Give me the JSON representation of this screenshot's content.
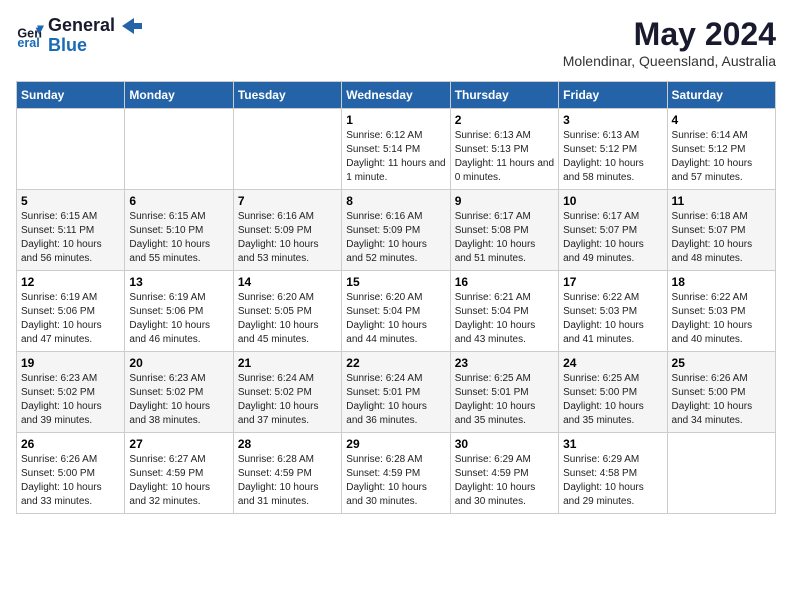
{
  "header": {
    "logo_general": "General",
    "logo_blue": "Blue",
    "month_year": "May 2024",
    "location": "Molendinar, Queensland, Australia"
  },
  "weekdays": [
    "Sunday",
    "Monday",
    "Tuesday",
    "Wednesday",
    "Thursday",
    "Friday",
    "Saturday"
  ],
  "weeks": [
    [
      {
        "day": "",
        "sunrise": "",
        "sunset": "",
        "daylight": ""
      },
      {
        "day": "",
        "sunrise": "",
        "sunset": "",
        "daylight": ""
      },
      {
        "day": "",
        "sunrise": "",
        "sunset": "",
        "daylight": ""
      },
      {
        "day": "1",
        "sunrise": "Sunrise: 6:12 AM",
        "sunset": "Sunset: 5:14 PM",
        "daylight": "Daylight: 11 hours and 1 minute."
      },
      {
        "day": "2",
        "sunrise": "Sunrise: 6:13 AM",
        "sunset": "Sunset: 5:13 PM",
        "daylight": "Daylight: 11 hours and 0 minutes."
      },
      {
        "day": "3",
        "sunrise": "Sunrise: 6:13 AM",
        "sunset": "Sunset: 5:12 PM",
        "daylight": "Daylight: 10 hours and 58 minutes."
      },
      {
        "day": "4",
        "sunrise": "Sunrise: 6:14 AM",
        "sunset": "Sunset: 5:12 PM",
        "daylight": "Daylight: 10 hours and 57 minutes."
      }
    ],
    [
      {
        "day": "5",
        "sunrise": "Sunrise: 6:15 AM",
        "sunset": "Sunset: 5:11 PM",
        "daylight": "Daylight: 10 hours and 56 minutes."
      },
      {
        "day": "6",
        "sunrise": "Sunrise: 6:15 AM",
        "sunset": "Sunset: 5:10 PM",
        "daylight": "Daylight: 10 hours and 55 minutes."
      },
      {
        "day": "7",
        "sunrise": "Sunrise: 6:16 AM",
        "sunset": "Sunset: 5:09 PM",
        "daylight": "Daylight: 10 hours and 53 minutes."
      },
      {
        "day": "8",
        "sunrise": "Sunrise: 6:16 AM",
        "sunset": "Sunset: 5:09 PM",
        "daylight": "Daylight: 10 hours and 52 minutes."
      },
      {
        "day": "9",
        "sunrise": "Sunrise: 6:17 AM",
        "sunset": "Sunset: 5:08 PM",
        "daylight": "Daylight: 10 hours and 51 minutes."
      },
      {
        "day": "10",
        "sunrise": "Sunrise: 6:17 AM",
        "sunset": "Sunset: 5:07 PM",
        "daylight": "Daylight: 10 hours and 49 minutes."
      },
      {
        "day": "11",
        "sunrise": "Sunrise: 6:18 AM",
        "sunset": "Sunset: 5:07 PM",
        "daylight": "Daylight: 10 hours and 48 minutes."
      }
    ],
    [
      {
        "day": "12",
        "sunrise": "Sunrise: 6:19 AM",
        "sunset": "Sunset: 5:06 PM",
        "daylight": "Daylight: 10 hours and 47 minutes."
      },
      {
        "day": "13",
        "sunrise": "Sunrise: 6:19 AM",
        "sunset": "Sunset: 5:06 PM",
        "daylight": "Daylight: 10 hours and 46 minutes."
      },
      {
        "day": "14",
        "sunrise": "Sunrise: 6:20 AM",
        "sunset": "Sunset: 5:05 PM",
        "daylight": "Daylight: 10 hours and 45 minutes."
      },
      {
        "day": "15",
        "sunrise": "Sunrise: 6:20 AM",
        "sunset": "Sunset: 5:04 PM",
        "daylight": "Daylight: 10 hours and 44 minutes."
      },
      {
        "day": "16",
        "sunrise": "Sunrise: 6:21 AM",
        "sunset": "Sunset: 5:04 PM",
        "daylight": "Daylight: 10 hours and 43 minutes."
      },
      {
        "day": "17",
        "sunrise": "Sunrise: 6:22 AM",
        "sunset": "Sunset: 5:03 PM",
        "daylight": "Daylight: 10 hours and 41 minutes."
      },
      {
        "day": "18",
        "sunrise": "Sunrise: 6:22 AM",
        "sunset": "Sunset: 5:03 PM",
        "daylight": "Daylight: 10 hours and 40 minutes."
      }
    ],
    [
      {
        "day": "19",
        "sunrise": "Sunrise: 6:23 AM",
        "sunset": "Sunset: 5:02 PM",
        "daylight": "Daylight: 10 hours and 39 minutes."
      },
      {
        "day": "20",
        "sunrise": "Sunrise: 6:23 AM",
        "sunset": "Sunset: 5:02 PM",
        "daylight": "Daylight: 10 hours and 38 minutes."
      },
      {
        "day": "21",
        "sunrise": "Sunrise: 6:24 AM",
        "sunset": "Sunset: 5:02 PM",
        "daylight": "Daylight: 10 hours and 37 minutes."
      },
      {
        "day": "22",
        "sunrise": "Sunrise: 6:24 AM",
        "sunset": "Sunset: 5:01 PM",
        "daylight": "Daylight: 10 hours and 36 minutes."
      },
      {
        "day": "23",
        "sunrise": "Sunrise: 6:25 AM",
        "sunset": "Sunset: 5:01 PM",
        "daylight": "Daylight: 10 hours and 35 minutes."
      },
      {
        "day": "24",
        "sunrise": "Sunrise: 6:25 AM",
        "sunset": "Sunset: 5:00 PM",
        "daylight": "Daylight: 10 hours and 35 minutes."
      },
      {
        "day": "25",
        "sunrise": "Sunrise: 6:26 AM",
        "sunset": "Sunset: 5:00 PM",
        "daylight": "Daylight: 10 hours and 34 minutes."
      }
    ],
    [
      {
        "day": "26",
        "sunrise": "Sunrise: 6:26 AM",
        "sunset": "Sunset: 5:00 PM",
        "daylight": "Daylight: 10 hours and 33 minutes."
      },
      {
        "day": "27",
        "sunrise": "Sunrise: 6:27 AM",
        "sunset": "Sunset: 4:59 PM",
        "daylight": "Daylight: 10 hours and 32 minutes."
      },
      {
        "day": "28",
        "sunrise": "Sunrise: 6:28 AM",
        "sunset": "Sunset: 4:59 PM",
        "daylight": "Daylight: 10 hours and 31 minutes."
      },
      {
        "day": "29",
        "sunrise": "Sunrise: 6:28 AM",
        "sunset": "Sunset: 4:59 PM",
        "daylight": "Daylight: 10 hours and 30 minutes."
      },
      {
        "day": "30",
        "sunrise": "Sunrise: 6:29 AM",
        "sunset": "Sunset: 4:59 PM",
        "daylight": "Daylight: 10 hours and 30 minutes."
      },
      {
        "day": "31",
        "sunrise": "Sunrise: 6:29 AM",
        "sunset": "Sunset: 4:58 PM",
        "daylight": "Daylight: 10 hours and 29 minutes."
      },
      {
        "day": "",
        "sunrise": "",
        "sunset": "",
        "daylight": ""
      }
    ]
  ]
}
